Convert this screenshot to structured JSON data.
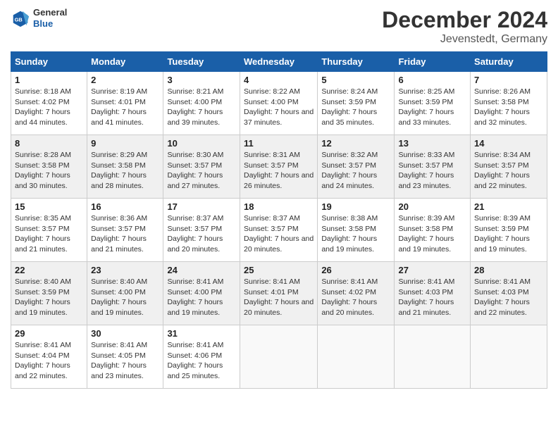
{
  "header": {
    "logo_general": "General",
    "logo_blue": "Blue",
    "title": "December 2024",
    "subtitle": "Jevenstedt, Germany"
  },
  "columns": [
    "Sunday",
    "Monday",
    "Tuesday",
    "Wednesday",
    "Thursday",
    "Friday",
    "Saturday"
  ],
  "weeks": [
    [
      {
        "day": "1",
        "sunrise": "Sunrise: 8:18 AM",
        "sunset": "Sunset: 4:02 PM",
        "daylight": "Daylight: 7 hours and 44 minutes."
      },
      {
        "day": "2",
        "sunrise": "Sunrise: 8:19 AM",
        "sunset": "Sunset: 4:01 PM",
        "daylight": "Daylight: 7 hours and 41 minutes."
      },
      {
        "day": "3",
        "sunrise": "Sunrise: 8:21 AM",
        "sunset": "Sunset: 4:00 PM",
        "daylight": "Daylight: 7 hours and 39 minutes."
      },
      {
        "day": "4",
        "sunrise": "Sunrise: 8:22 AM",
        "sunset": "Sunset: 4:00 PM",
        "daylight": "Daylight: 7 hours and 37 minutes."
      },
      {
        "day": "5",
        "sunrise": "Sunrise: 8:24 AM",
        "sunset": "Sunset: 3:59 PM",
        "daylight": "Daylight: 7 hours and 35 minutes."
      },
      {
        "day": "6",
        "sunrise": "Sunrise: 8:25 AM",
        "sunset": "Sunset: 3:59 PM",
        "daylight": "Daylight: 7 hours and 33 minutes."
      },
      {
        "day": "7",
        "sunrise": "Sunrise: 8:26 AM",
        "sunset": "Sunset: 3:58 PM",
        "daylight": "Daylight: 7 hours and 32 minutes."
      }
    ],
    [
      {
        "day": "8",
        "sunrise": "Sunrise: 8:28 AM",
        "sunset": "Sunset: 3:58 PM",
        "daylight": "Daylight: 7 hours and 30 minutes."
      },
      {
        "day": "9",
        "sunrise": "Sunrise: 8:29 AM",
        "sunset": "Sunset: 3:58 PM",
        "daylight": "Daylight: 7 hours and 28 minutes."
      },
      {
        "day": "10",
        "sunrise": "Sunrise: 8:30 AM",
        "sunset": "Sunset: 3:57 PM",
        "daylight": "Daylight: 7 hours and 27 minutes."
      },
      {
        "day": "11",
        "sunrise": "Sunrise: 8:31 AM",
        "sunset": "Sunset: 3:57 PM",
        "daylight": "Daylight: 7 hours and 26 minutes."
      },
      {
        "day": "12",
        "sunrise": "Sunrise: 8:32 AM",
        "sunset": "Sunset: 3:57 PM",
        "daylight": "Daylight: 7 hours and 24 minutes."
      },
      {
        "day": "13",
        "sunrise": "Sunrise: 8:33 AM",
        "sunset": "Sunset: 3:57 PM",
        "daylight": "Daylight: 7 hours and 23 minutes."
      },
      {
        "day": "14",
        "sunrise": "Sunrise: 8:34 AM",
        "sunset": "Sunset: 3:57 PM",
        "daylight": "Daylight: 7 hours and 22 minutes."
      }
    ],
    [
      {
        "day": "15",
        "sunrise": "Sunrise: 8:35 AM",
        "sunset": "Sunset: 3:57 PM",
        "daylight": "Daylight: 7 hours and 21 minutes."
      },
      {
        "day": "16",
        "sunrise": "Sunrise: 8:36 AM",
        "sunset": "Sunset: 3:57 PM",
        "daylight": "Daylight: 7 hours and 21 minutes."
      },
      {
        "day": "17",
        "sunrise": "Sunrise: 8:37 AM",
        "sunset": "Sunset: 3:57 PM",
        "daylight": "Daylight: 7 hours and 20 minutes."
      },
      {
        "day": "18",
        "sunrise": "Sunrise: 8:37 AM",
        "sunset": "Sunset: 3:57 PM",
        "daylight": "Daylight: 7 hours and 20 minutes."
      },
      {
        "day": "19",
        "sunrise": "Sunrise: 8:38 AM",
        "sunset": "Sunset: 3:58 PM",
        "daylight": "Daylight: 7 hours and 19 minutes."
      },
      {
        "day": "20",
        "sunrise": "Sunrise: 8:39 AM",
        "sunset": "Sunset: 3:58 PM",
        "daylight": "Daylight: 7 hours and 19 minutes."
      },
      {
        "day": "21",
        "sunrise": "Sunrise: 8:39 AM",
        "sunset": "Sunset: 3:59 PM",
        "daylight": "Daylight: 7 hours and 19 minutes."
      }
    ],
    [
      {
        "day": "22",
        "sunrise": "Sunrise: 8:40 AM",
        "sunset": "Sunset: 3:59 PM",
        "daylight": "Daylight: 7 hours and 19 minutes."
      },
      {
        "day": "23",
        "sunrise": "Sunrise: 8:40 AM",
        "sunset": "Sunset: 4:00 PM",
        "daylight": "Daylight: 7 hours and 19 minutes."
      },
      {
        "day": "24",
        "sunrise": "Sunrise: 8:41 AM",
        "sunset": "Sunset: 4:00 PM",
        "daylight": "Daylight: 7 hours and 19 minutes."
      },
      {
        "day": "25",
        "sunrise": "Sunrise: 8:41 AM",
        "sunset": "Sunset: 4:01 PM",
        "daylight": "Daylight: 7 hours and 20 minutes."
      },
      {
        "day": "26",
        "sunrise": "Sunrise: 8:41 AM",
        "sunset": "Sunset: 4:02 PM",
        "daylight": "Daylight: 7 hours and 20 minutes."
      },
      {
        "day": "27",
        "sunrise": "Sunrise: 8:41 AM",
        "sunset": "Sunset: 4:03 PM",
        "daylight": "Daylight: 7 hours and 21 minutes."
      },
      {
        "day": "28",
        "sunrise": "Sunrise: 8:41 AM",
        "sunset": "Sunset: 4:03 PM",
        "daylight": "Daylight: 7 hours and 22 minutes."
      }
    ],
    [
      {
        "day": "29",
        "sunrise": "Sunrise: 8:41 AM",
        "sunset": "Sunset: 4:04 PM",
        "daylight": "Daylight: 7 hours and 22 minutes."
      },
      {
        "day": "30",
        "sunrise": "Sunrise: 8:41 AM",
        "sunset": "Sunset: 4:05 PM",
        "daylight": "Daylight: 7 hours and 23 minutes."
      },
      {
        "day": "31",
        "sunrise": "Sunrise: 8:41 AM",
        "sunset": "Sunset: 4:06 PM",
        "daylight": "Daylight: 7 hours and 25 minutes."
      },
      null,
      null,
      null,
      null
    ]
  ]
}
